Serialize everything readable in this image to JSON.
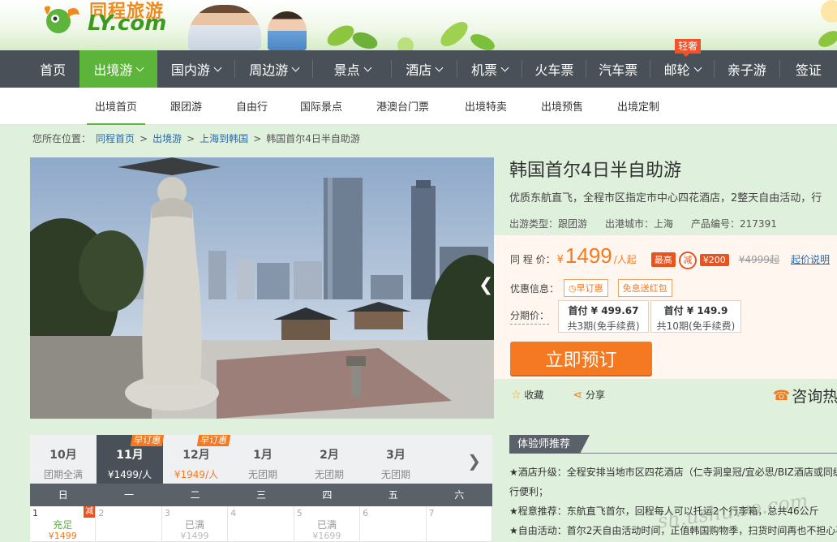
{
  "brand": {
    "name_cn": "同程旅游",
    "name_en": "LY.com"
  },
  "main_nav": [
    {
      "label": "首页",
      "caret": false,
      "active": false
    },
    {
      "label": "出境游",
      "caret": true,
      "active": true
    },
    {
      "label": "国内游",
      "caret": true,
      "active": false
    },
    {
      "label": "周边游",
      "caret": true,
      "active": false
    },
    {
      "label": "景点",
      "caret": true,
      "active": false
    },
    {
      "label": "酒店",
      "caret": true,
      "active": false
    },
    {
      "label": "机票",
      "caret": true,
      "active": false
    },
    {
      "label": "火车票",
      "caret": false,
      "active": false
    },
    {
      "label": "汽车票",
      "caret": false,
      "active": false
    },
    {
      "label": "邮轮",
      "caret": true,
      "active": false,
      "badge": "轻奢"
    },
    {
      "label": "亲子游",
      "caret": false,
      "active": false
    },
    {
      "label": "签证",
      "caret": false,
      "active": false
    }
  ],
  "sub_nav": [
    "出境首页",
    "跟团游",
    "自由行",
    "国际景点",
    "港澳台门票",
    "出境特卖",
    "出境预售",
    "出境定制"
  ],
  "breadcrumb": {
    "prefix": "您所在位置：",
    "links": [
      "同程首页",
      "出境游",
      "上海到韩国"
    ],
    "current": "韩国首尔4日半自助游",
    "sep": ">"
  },
  "product": {
    "title": "韩国首尔4日半自助游",
    "subtitle": "优质东航直飞，全程市区指定市中心四花酒店，2整天自由活动，行",
    "type_label": "出游类型：跟团游",
    "city_label": "出港城市：上海",
    "code_label": "产品编号：217391"
  },
  "price": {
    "label": "同 程 价：",
    "currency": "¥",
    "value": "1499",
    "unit": "/人起",
    "discount_prefix": "最高",
    "discount_icon": "减",
    "discount_value": "¥200",
    "original": "¥4999起",
    "explain_link": "起价说明"
  },
  "promo": {
    "label": "优惠信息：",
    "tags": [
      "早订惠",
      "免息送红包"
    ]
  },
  "installment": {
    "label": "分期价：",
    "options": [
      {
        "first": "首付 ¥ 499.67",
        "terms": "共3期(免手续费)"
      },
      {
        "first": "首付 ¥ 149.9",
        "terms": "共10期(免手续费)"
      }
    ]
  },
  "actions": {
    "book": "立即预订",
    "favorite": "收藏",
    "share": "分享",
    "consult": "咨询热"
  },
  "calendar": {
    "months": [
      {
        "name": "10月",
        "status": "团期全满",
        "active": false,
        "early": ""
      },
      {
        "name": "11月",
        "status": "¥1499/人",
        "active": true,
        "early": "早订惠"
      },
      {
        "name": "12月",
        "status": "¥1949/人",
        "active": false,
        "early": "早订惠"
      },
      {
        "name": "1月",
        "status": "无团期",
        "active": false,
        "early": ""
      },
      {
        "name": "2月",
        "status": "无团期",
        "active": false,
        "early": ""
      },
      {
        "name": "3月",
        "status": "无团期",
        "active": false,
        "early": ""
      }
    ],
    "weekdays": [
      "日",
      "一",
      "二",
      "三",
      "四",
      "五",
      "六"
    ],
    "days": [
      {
        "day": "1",
        "status": "充足",
        "price": "¥1499",
        "avail": true,
        "jian": "减"
      },
      {
        "day": "2",
        "status": "",
        "price": "",
        "avail": false,
        "jian": ""
      },
      {
        "day": "3",
        "status": "已满",
        "price": "¥1499",
        "avail": false,
        "jian": ""
      },
      {
        "day": "4",
        "status": "",
        "price": "",
        "avail": false,
        "jian": ""
      },
      {
        "day": "5",
        "status": "已满",
        "price": "¥1699",
        "avail": false,
        "jian": ""
      },
      {
        "day": "6",
        "status": "",
        "price": "",
        "avail": false,
        "jian": ""
      },
      {
        "day": "7",
        "status": "",
        "price": "",
        "avail": false,
        "jian": ""
      }
    ]
  },
  "recommend": {
    "title": "体验师推荐",
    "lines": [
      "★酒店升级：全程安排当地市区四花酒店（仁寺洞皇冠/宜必思/BIZ酒店或同级",
      "行便利；",
      "★程意推荐：东航直飞首尔，回程每人可以托运2个行李箱，总共46公斤",
      "★自由活动：首尔2天自由活动时间，正值韩国购物季，扫货时间再也不担心不"
    ],
    "watermark": "sh.ushuwo.com"
  },
  "colors": {
    "green": "#5db43a",
    "nav": "#4a5057",
    "orange": "#f47920",
    "red": "#e8541f",
    "link": "#2a6aa8"
  }
}
